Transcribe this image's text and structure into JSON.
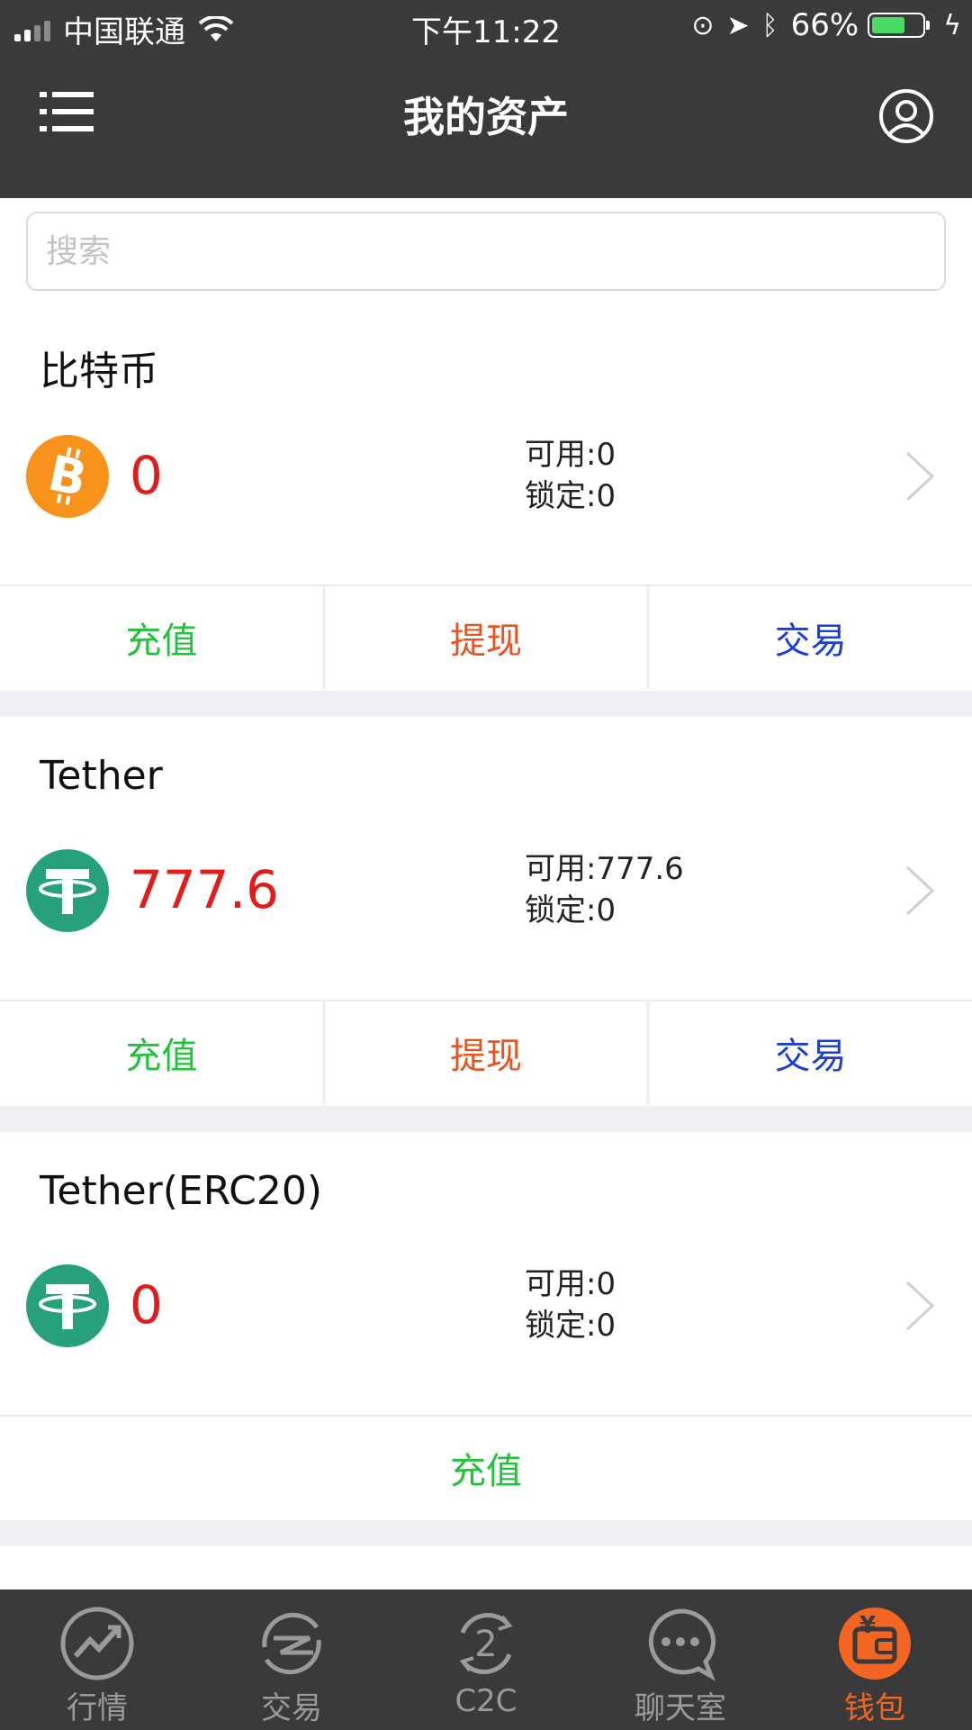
{
  "status_bar": {
    "carrier": "中国联通",
    "time": "下午11:22",
    "battery": "66%",
    "battery_level": 0.66
  },
  "nav": {
    "title": "我的资产"
  },
  "search": {
    "placeholder": "搜索"
  },
  "colors": {
    "bar_bg": "#3a3a3a",
    "amount_red": "#e21b1b",
    "deposit_green": "#22c33a",
    "withdraw_orange": "#e8531f",
    "trade_blue": "#1b3fd6",
    "active_tab": "#f26522",
    "btc_orange": "#f7931a",
    "tether_green": "#26a17b"
  },
  "assets": [
    {
      "name": "比特币",
      "icon": "bitcoin-icon",
      "amount": "0",
      "available": "可用:0",
      "locked": "锁定:0",
      "actions": [
        "充值",
        "提现",
        "交易"
      ]
    },
    {
      "name": "Tether",
      "icon": "tether-icon",
      "amount": "777.6",
      "available": "可用:777.6",
      "locked": "锁定:0",
      "actions": [
        "充值",
        "提现",
        "交易"
      ]
    },
    {
      "name": "Tether(ERC20)",
      "icon": "tether-icon",
      "amount": "0",
      "available": "可用:0",
      "locked": "锁定:0",
      "actions": [
        "充值"
      ]
    }
  ],
  "tabs": [
    {
      "label": "行情",
      "icon": "market-chart-icon",
      "active": false
    },
    {
      "label": "交易",
      "icon": "exchange-icon",
      "active": false
    },
    {
      "label": "C2C",
      "icon": "c2c-icon",
      "active": false
    },
    {
      "label": "聊天室",
      "icon": "chat-icon",
      "active": false
    },
    {
      "label": "钱包",
      "icon": "wallet-icon",
      "active": true
    }
  ]
}
